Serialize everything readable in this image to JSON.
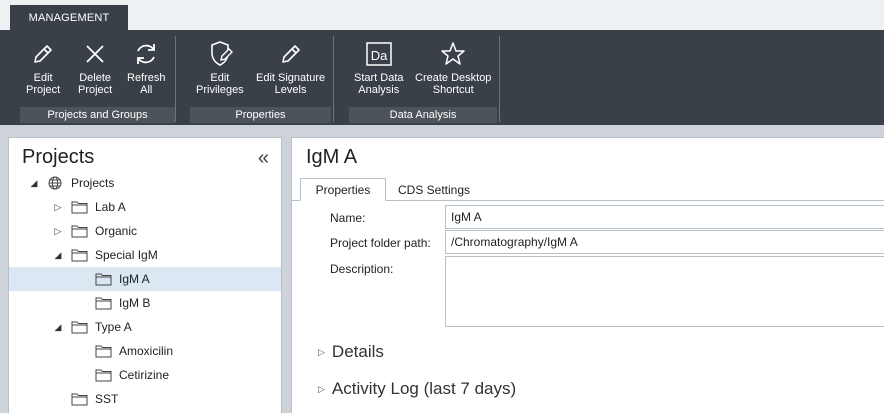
{
  "ribbon": {
    "tab_label": "MANAGEMENT",
    "groups": [
      {
        "caption": "Projects and Groups",
        "buttons": [
          {
            "label": "Edit\nProject",
            "icon": "pencil-icon"
          },
          {
            "label": "Delete\nProject",
            "icon": "close-icon"
          },
          {
            "label": "Refresh\nAll",
            "icon": "refresh-icon"
          }
        ]
      },
      {
        "caption": "Properties",
        "buttons": [
          {
            "label": "Edit\nPrivileges",
            "icon": "shield-pencil-icon"
          },
          {
            "label": "Edit Signature\nLevels",
            "icon": "pencil-icon"
          }
        ]
      },
      {
        "caption": "Data Analysis",
        "buttons": [
          {
            "label": "Start Data\nAnalysis",
            "icon": "data-analysis-icon"
          },
          {
            "label": "Create Desktop\nShortcut",
            "icon": "star-icon"
          }
        ]
      }
    ]
  },
  "left_panel": {
    "title": "Projects",
    "collapse_glyph": "«",
    "tree": [
      {
        "label": "Projects",
        "expander": "expanded",
        "icon": "globe-icon"
      },
      {
        "label": "Lab A",
        "expander": "collapsed",
        "icon": "folder-icon"
      },
      {
        "label": "Organic",
        "expander": "collapsed",
        "icon": "folder-icon"
      },
      {
        "label": "Special IgM",
        "expander": "expanded",
        "icon": "folder-icon"
      },
      {
        "label": "IgM A",
        "expander": "none",
        "icon": "folder-icon",
        "selected": true
      },
      {
        "label": "IgM B",
        "expander": "none",
        "icon": "folder-icon"
      },
      {
        "label": "Type A",
        "expander": "expanded",
        "icon": "folder-icon"
      },
      {
        "label": "Amoxicilin",
        "expander": "none",
        "icon": "folder-icon"
      },
      {
        "label": "Cetirizine",
        "expander": "none",
        "icon": "folder-icon"
      },
      {
        "label": "SST",
        "expander": "none",
        "icon": "folder-icon"
      }
    ]
  },
  "detail": {
    "title": "IgM A",
    "tabs": [
      {
        "label": "Properties",
        "active": true
      },
      {
        "label": "CDS Settings",
        "active": false
      }
    ],
    "fields": {
      "name_label": "Name:",
      "name_value": "IgM A",
      "path_label": "Project folder path:",
      "path_value": "/Chromatography/IgM A",
      "description_label": "Description:",
      "description_value": ""
    },
    "sections": [
      {
        "label": "Details"
      },
      {
        "label": "Activity Log (last 7 days)"
      }
    ]
  },
  "colors": {
    "ribbon_dark": "#3a4047",
    "selection": "#dbe8f3",
    "background": "#cdd3d9"
  }
}
